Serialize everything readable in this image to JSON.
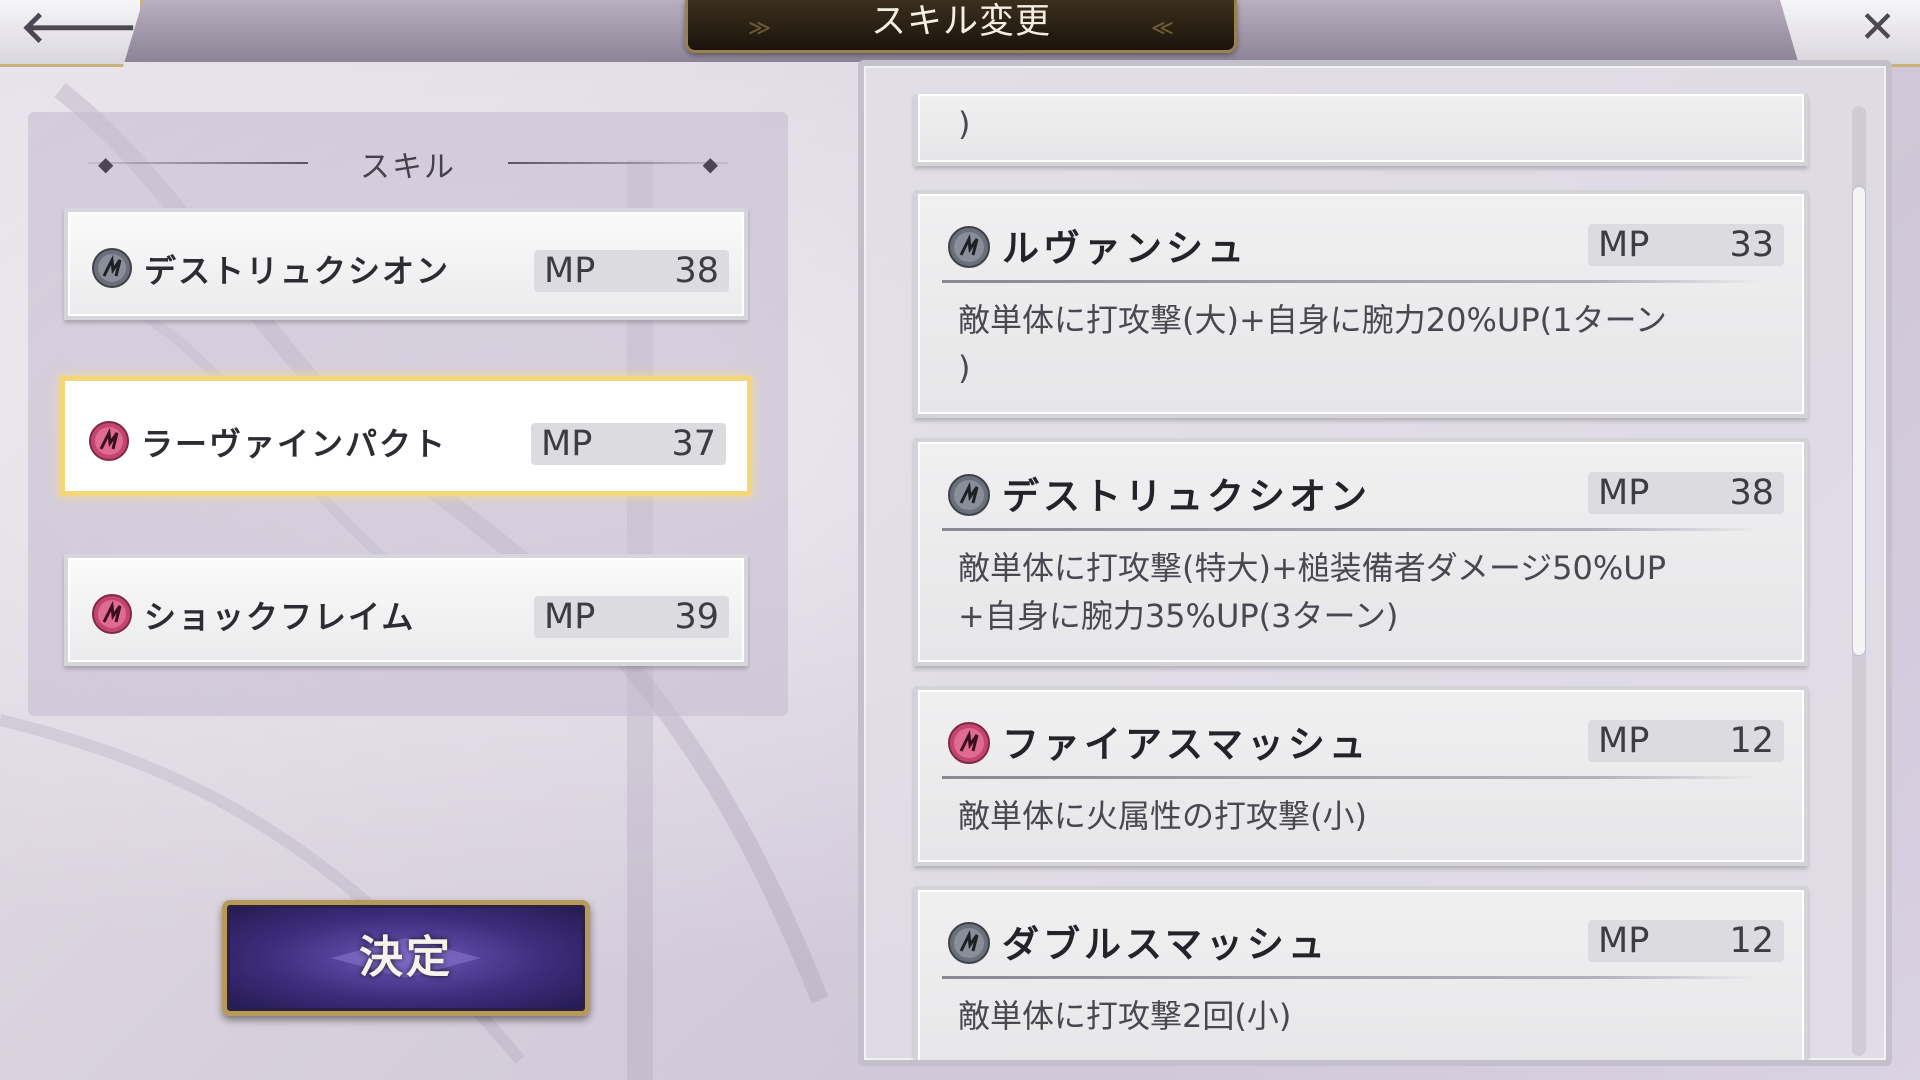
{
  "header": {
    "title": "スキル変更",
    "back_icon": "back-arrow-icon",
    "close_icon": "close-icon"
  },
  "colors": {
    "icon_gray": "#6b6f7a",
    "icon_pink": "#c4466f",
    "selected_border": "#f3d57b",
    "button_purple": "#3d2d7c",
    "gold_trim": "#b79a58"
  },
  "equipped": {
    "section_label": "スキル",
    "slots": [
      {
        "name": "デストリュクシオン",
        "mp_label": "MP",
        "mp": "38",
        "icon": "gray",
        "selected": false
      },
      {
        "name": "ラーヴァインパクト",
        "mp_label": "MP",
        "mp": "37",
        "icon": "pink",
        "selected": true
      },
      {
        "name": "ショックフレイム",
        "mp_label": "MP",
        "mp": "39",
        "icon": "pink",
        "selected": false
      }
    ]
  },
  "decide_button": {
    "label": "決定"
  },
  "skill_list": {
    "partial_top_desc": ")",
    "cards": [
      {
        "name": "ルヴァンシュ",
        "mp_label": "MP",
        "mp": "33",
        "icon": "gray",
        "desc_line1": "敵単体に打攻撃(大)+自身に腕力20%UP(1ターン",
        "desc_line2": ")"
      },
      {
        "name": "デストリュクシオン",
        "mp_label": "MP",
        "mp": "38",
        "icon": "gray",
        "desc_line1": "敵単体に打攻撃(特大)+槌装備者ダメージ50%UP",
        "desc_line2": "+自身に腕力35%UP(3ターン)"
      },
      {
        "name": "ファイアスマッシュ",
        "mp_label": "MP",
        "mp": "12",
        "icon": "pink",
        "desc_line1": "敵単体に火属性の打攻撃(小)",
        "desc_line2": ""
      },
      {
        "name": "ダブルスマッシュ",
        "mp_label": "MP",
        "mp": "12",
        "icon": "gray",
        "desc_line1": "敵単体に打攻撃2回(小)",
        "desc_line2": ""
      }
    ]
  }
}
